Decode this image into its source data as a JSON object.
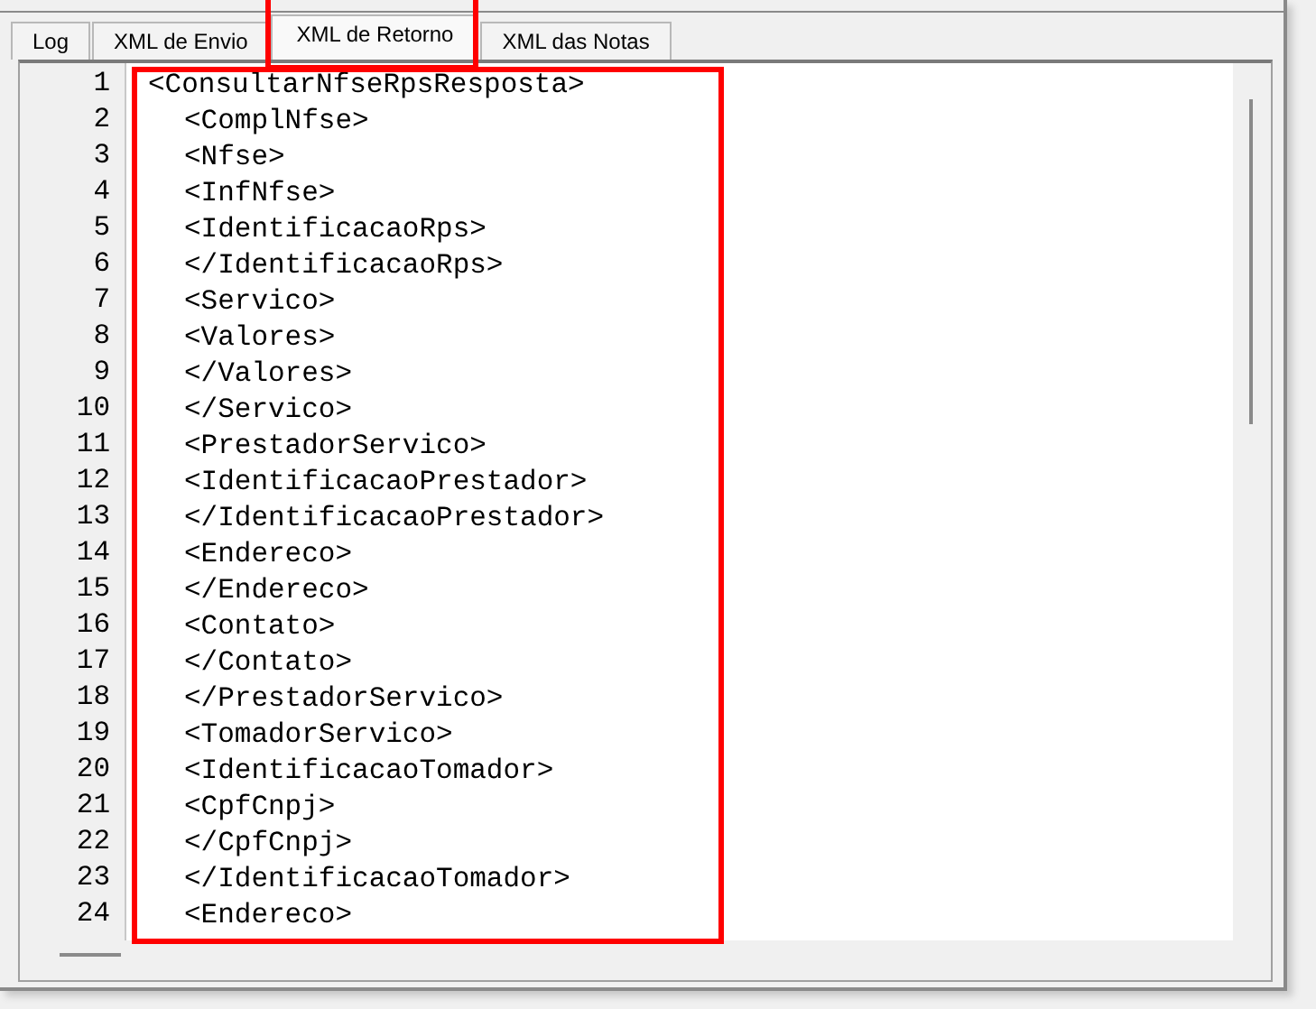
{
  "tabs": [
    {
      "label": "Log",
      "selected": false
    },
    {
      "label": "XML de Envio",
      "selected": false
    },
    {
      "label": "XML de Retorno",
      "selected": true
    },
    {
      "label": "XML das Notas",
      "selected": false
    }
  ],
  "editor": {
    "lines": [
      {
        "number": "1",
        "text": "<ConsultarNfseRpsResposta>",
        "children": [
          {
            "number": "2",
            "text": "<ComplNfse>"
          },
          {
            "number": "3",
            "text": "<Nfse>"
          },
          {
            "number": "4",
            "text": "<InfNfse>"
          },
          {
            "number": "5",
            "text": "<IdentificacaoRps>"
          },
          {
            "number": "6",
            "text": "</IdentificacaoRps>"
          },
          {
            "number": "7",
            "text": "<Servico>"
          },
          {
            "number": "8",
            "text": "<Valores>"
          },
          {
            "number": "9",
            "text": "</Valores>"
          },
          {
            "number": "10",
            "text": "</Servico>"
          },
          {
            "number": "11",
            "text": "<PrestadorServico>"
          },
          {
            "number": "12",
            "text": "<IdentificacaoPrestador>"
          },
          {
            "number": "13",
            "text": "</IdentificacaoPrestador>"
          },
          {
            "number": "14",
            "text": "<Endereco>"
          },
          {
            "number": "15",
            "text": "</Endereco>"
          },
          {
            "number": "16",
            "text": "<Contato>"
          },
          {
            "number": "17",
            "text": "</Contato>"
          },
          {
            "number": "18",
            "text": "</PrestadorServico>"
          },
          {
            "number": "19",
            "text": "<TomadorServico>"
          },
          {
            "number": "20",
            "text": "<IdentificacaoTomador>"
          },
          {
            "number": "21",
            "text": "<CpfCnpj>"
          },
          {
            "number": "22",
            "text": "</CpfCnpj>"
          },
          {
            "number": "23",
            "text": "</IdentificacaoTomador>"
          },
          {
            "number": "24",
            "text": "<Endereco>"
          }
        ]
      }
    ]
  }
}
